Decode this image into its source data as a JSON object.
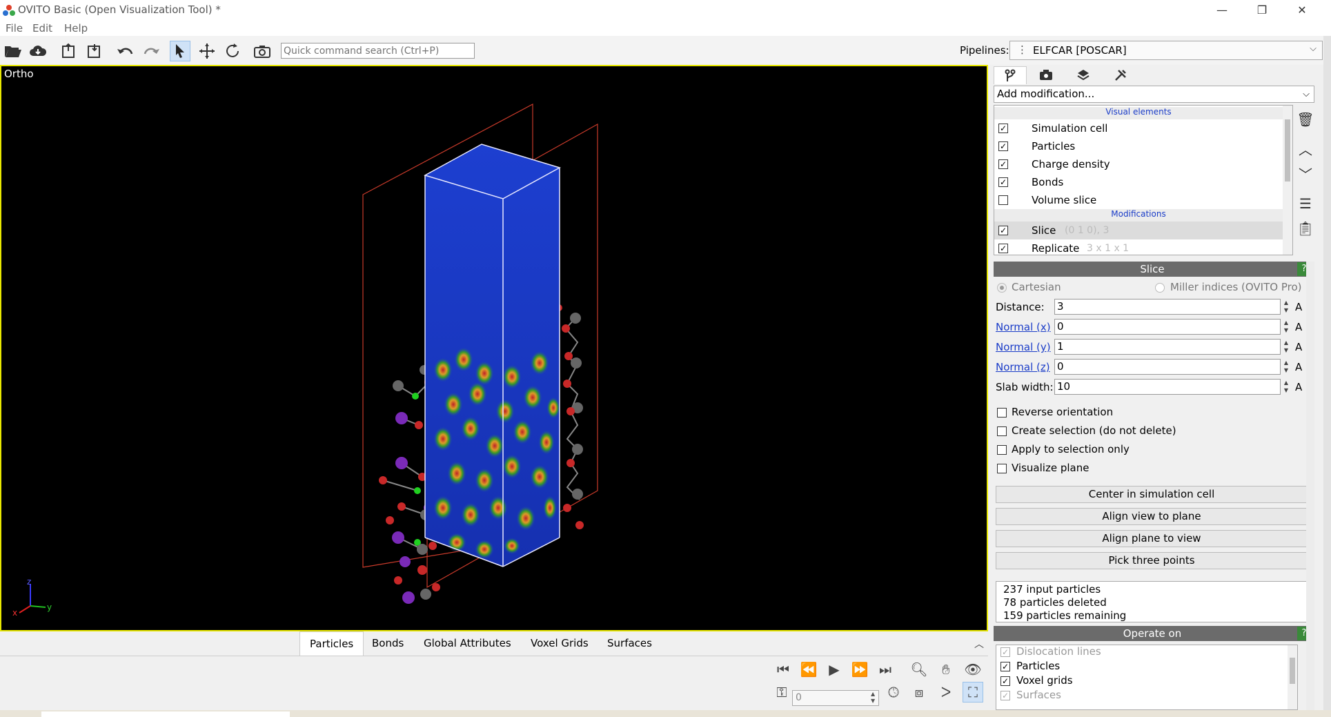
{
  "window": {
    "title": "OVITO Basic (Open Visualization Tool) *",
    "minimize": "—",
    "restore": "❐",
    "close": "✕"
  },
  "menu": [
    "File",
    "Edit",
    "Help"
  ],
  "toolbar": {
    "search_placeholder": "Quick command search (Ctrl+P)"
  },
  "pipeline_selector": {
    "label": "Pipelines:",
    "selected": "ELFCAR [POSCAR]"
  },
  "viewport": {
    "label": "Ortho",
    "axes": {
      "z": "z",
      "x": "x",
      "y": "y"
    }
  },
  "data_inspector_tabs": [
    "Particles",
    "Bonds",
    "Global Attributes",
    "Voxel Grids",
    "Surfaces"
  ],
  "animation": {
    "frame": "0"
  },
  "command_panel": {
    "add_modification": "Add modification...",
    "visual_elements_header": "Visual elements",
    "visual_elements": [
      {
        "label": "Simulation cell",
        "checked": true
      },
      {
        "label": "Particles",
        "checked": true
      },
      {
        "label": "Charge density",
        "checked": true
      },
      {
        "label": "Bonds",
        "checked": true
      },
      {
        "label": "Volume slice",
        "checked": false
      }
    ],
    "modifications_header": "Modifications",
    "modifications": [
      {
        "label": "Slice",
        "sub": "(0 1 0), 3",
        "checked": true,
        "selected": true
      },
      {
        "label": "Replicate",
        "sub": "3 x 1 x 1",
        "checked": true,
        "selected": false
      }
    ]
  },
  "slice": {
    "title": "Slice",
    "help": "?",
    "mode_cartesian": "Cartesian",
    "mode_miller": "Miller indices (OVITO Pro)",
    "fields": [
      {
        "label": "Distance:",
        "value": "3",
        "unit": "A",
        "link": false
      },
      {
        "label": "Normal (x)",
        "value": "0",
        "unit": "A",
        "link": true
      },
      {
        "label": "Normal (y)",
        "value": "1",
        "unit": "A",
        "link": true
      },
      {
        "label": "Normal (z)",
        "value": "0",
        "unit": "A",
        "link": true
      },
      {
        "label": "Slab width:",
        "value": "10",
        "unit": "A",
        "link": false
      }
    ],
    "options": [
      {
        "label": "Reverse orientation",
        "checked": false
      },
      {
        "label": "Create selection (do not delete)",
        "checked": false
      },
      {
        "label": "Apply to selection only",
        "checked": false
      },
      {
        "label": "Visualize plane",
        "checked": false
      }
    ],
    "buttons": [
      "Center in simulation cell",
      "Align view to plane",
      "Align plane to view",
      "Pick three points"
    ],
    "status": [
      "237 input particles",
      "78 particles deleted",
      "159 particles remaining"
    ]
  },
  "operate_on": {
    "title": "Operate on",
    "help": "?",
    "items": [
      {
        "label": "Dislocation lines",
        "checked": true,
        "enabled": false
      },
      {
        "label": "Particles",
        "checked": true,
        "enabled": true
      },
      {
        "label": "Voxel grids",
        "checked": true,
        "enabled": true
      },
      {
        "label": "Surfaces",
        "checked": true,
        "enabled": false
      }
    ]
  }
}
